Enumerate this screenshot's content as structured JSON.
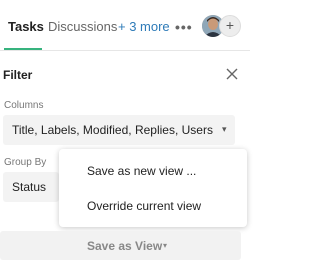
{
  "tabs": {
    "active": "Tasks",
    "discussions": "Discussions",
    "more": "+ 3 more",
    "overflow": "•••",
    "avatar_add": "+"
  },
  "filter": {
    "title": "Filter",
    "columns_label": "Columns",
    "columns_value": "Title, Labels, Modified, Replies, Users",
    "group_by_label": "Group By",
    "group_by_value": "Status"
  },
  "menu": {
    "items": [
      "Save as new view ...",
      "Override current view"
    ]
  },
  "save_view": {
    "label": "Save as View"
  },
  "icons": {
    "close": "close-icon",
    "dropdown": "chevron-down-icon"
  },
  "colors": {
    "tab_underline": "#36b37e",
    "link": "#2e7bb8"
  }
}
